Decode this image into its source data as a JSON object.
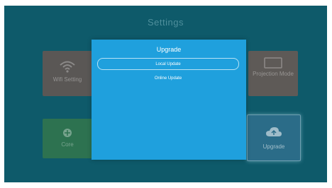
{
  "screen": {
    "title": "Settings"
  },
  "tiles": {
    "wifi": {
      "label": "Wifi Setting",
      "icon": "wifi-icon"
    },
    "projection": {
      "label": "Projection Mode",
      "icon": "projector-icon"
    },
    "core": {
      "label": "Core",
      "icon": "core-icon"
    },
    "upgrade": {
      "label": "Upgrade",
      "icon": "cloud-upload-icon"
    }
  },
  "dialog": {
    "title": "Upgrade",
    "options": [
      "Local Update",
      "Online Update"
    ],
    "selected": "Local Update"
  },
  "colors": {
    "background": "#0e5a6a",
    "dialog": "#1fa0dd",
    "tile_wifi": "#5a5755",
    "tile_core": "#2d7250",
    "tile_upgrade": "#2b6c88"
  }
}
